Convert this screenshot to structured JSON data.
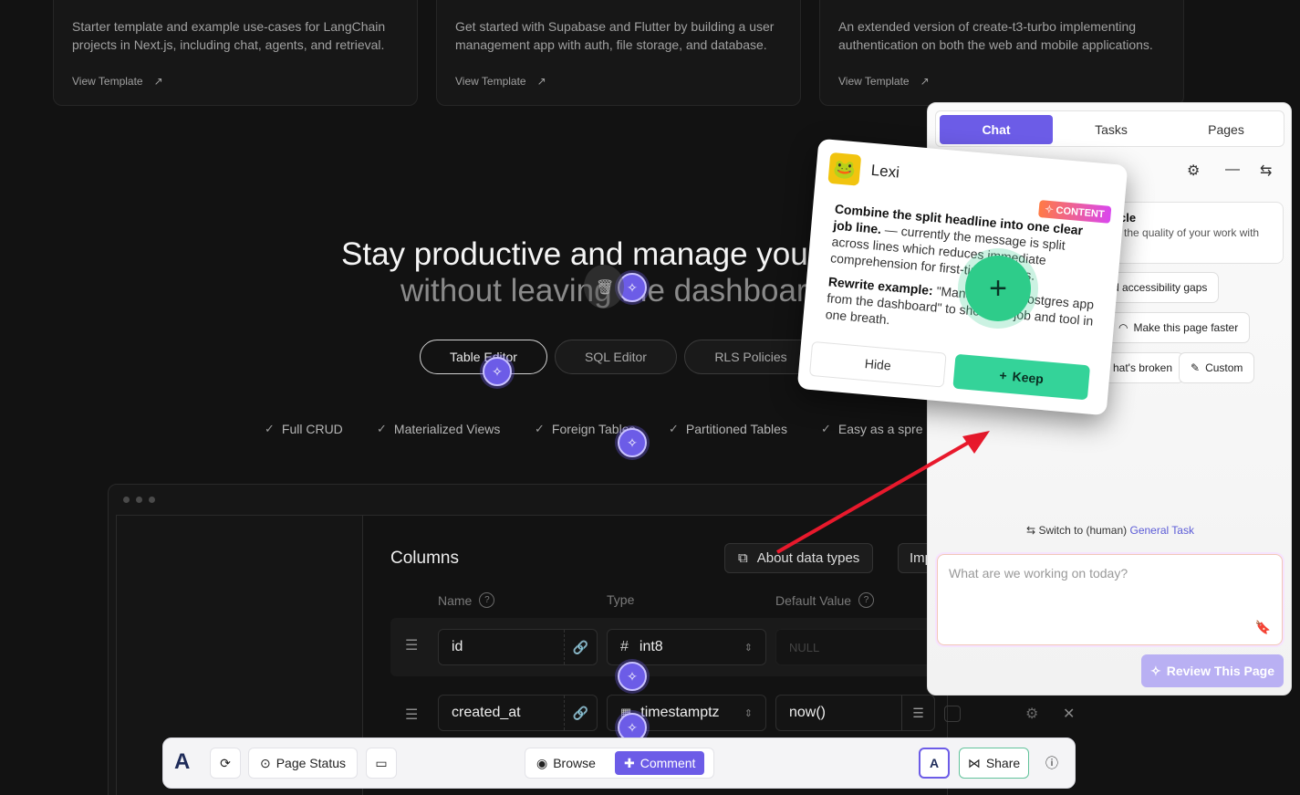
{
  "templates": [
    {
      "desc": "Starter template and example use-cases for LangChain projects in Next.js, including chat, agents, and retrieval.",
      "link": "View Template"
    },
    {
      "desc": "Get started with Supabase and Flutter by building a user management app with auth, file storage, and database.",
      "link": "View Template"
    },
    {
      "desc": "An extended version of create-t3-turbo implementing authentication on both the web and mobile applications.",
      "link": "View Template"
    }
  ],
  "hero": {
    "line1": "Stay productive and manage you",
    "line2": "without leaving the dashboar"
  },
  "tabs": [
    "Table Editor",
    "SQL Editor",
    "RLS Policies"
  ],
  "features": [
    "Full CRUD",
    "Materialized Views",
    "Foreign Tables",
    "Partitioned Tables",
    "Easy as a spre"
  ],
  "editor": {
    "title": "Columns",
    "about_btn": "About data types",
    "import_btn": "Imp",
    "headers": {
      "name": "Name",
      "type": "Type",
      "default": "Default Value"
    },
    "rows": [
      {
        "name": "id",
        "type": "int8",
        "type_icon": "#",
        "default": "NULL"
      },
      {
        "name": "created_at",
        "type": "timestamptz",
        "type_icon": "calendar",
        "default": "now()"
      }
    ]
  },
  "toolbar": {
    "page_status": "Page Status",
    "browse": "Browse",
    "comment": "Comment",
    "share": "Share"
  },
  "panel": {
    "tabs": [
      "Chat",
      "Tasks",
      "Pages"
    ],
    "card_title": "rcle",
    "card_sub": "e the quality of your work with",
    "chips": [
      "d accessibility gaps",
      "Make this page faster",
      "hat's broken",
      "Custom"
    ],
    "switch_text": "Switch to (human)",
    "switch_link": "General Task",
    "input_placeholder": "What are we working on today?",
    "review_btn": "Review This Page"
  },
  "lexi": {
    "name": "Lexi",
    "tag": "CONTENT",
    "bold1": "Combine the split headline into one clear job line.",
    "text1": " — currently the message is split across lines which reduces immediate comprehension for first-time visitors.",
    "bold2": "Rewrite example:",
    "text2": " \"Manage your Postgres app from the dashboard\" to show the job and tool in one breath.",
    "hide": "Hide",
    "keep": "Keep"
  },
  "colors": {
    "accent": "#6c5ce7",
    "keep": "#34d399",
    "arrow": "#e8192c"
  }
}
